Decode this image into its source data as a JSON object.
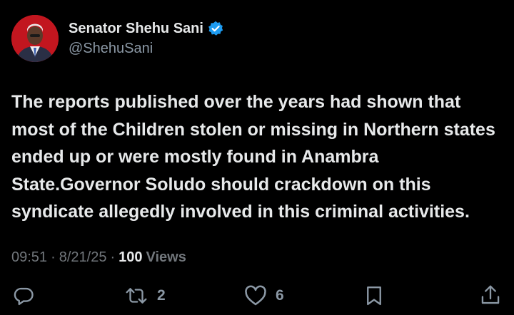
{
  "author": {
    "display_name": "Senator Shehu Sani",
    "handle": "@ShehuSani",
    "verified": true,
    "verified_color": "#1d9bf0"
  },
  "tweet": {
    "text": "The reports published over the years had shown that most of the Children stolen or missing in Northern states ended up or were mostly found in Anambra State.Governor Soludo should crackdown on this syndicate allegedly involved in this criminal activities.",
    "time": "09:51",
    "date": "8/21/25",
    "views_count": "100",
    "views_label": "Views"
  },
  "actions": {
    "reply_icon": "reply-icon",
    "retweet_icon": "retweet-icon",
    "retweet_count": "2",
    "like_icon": "heart-icon",
    "like_count": "6",
    "bookmark_icon": "bookmark-icon",
    "share_icon": "share-icon"
  },
  "separator": "·"
}
